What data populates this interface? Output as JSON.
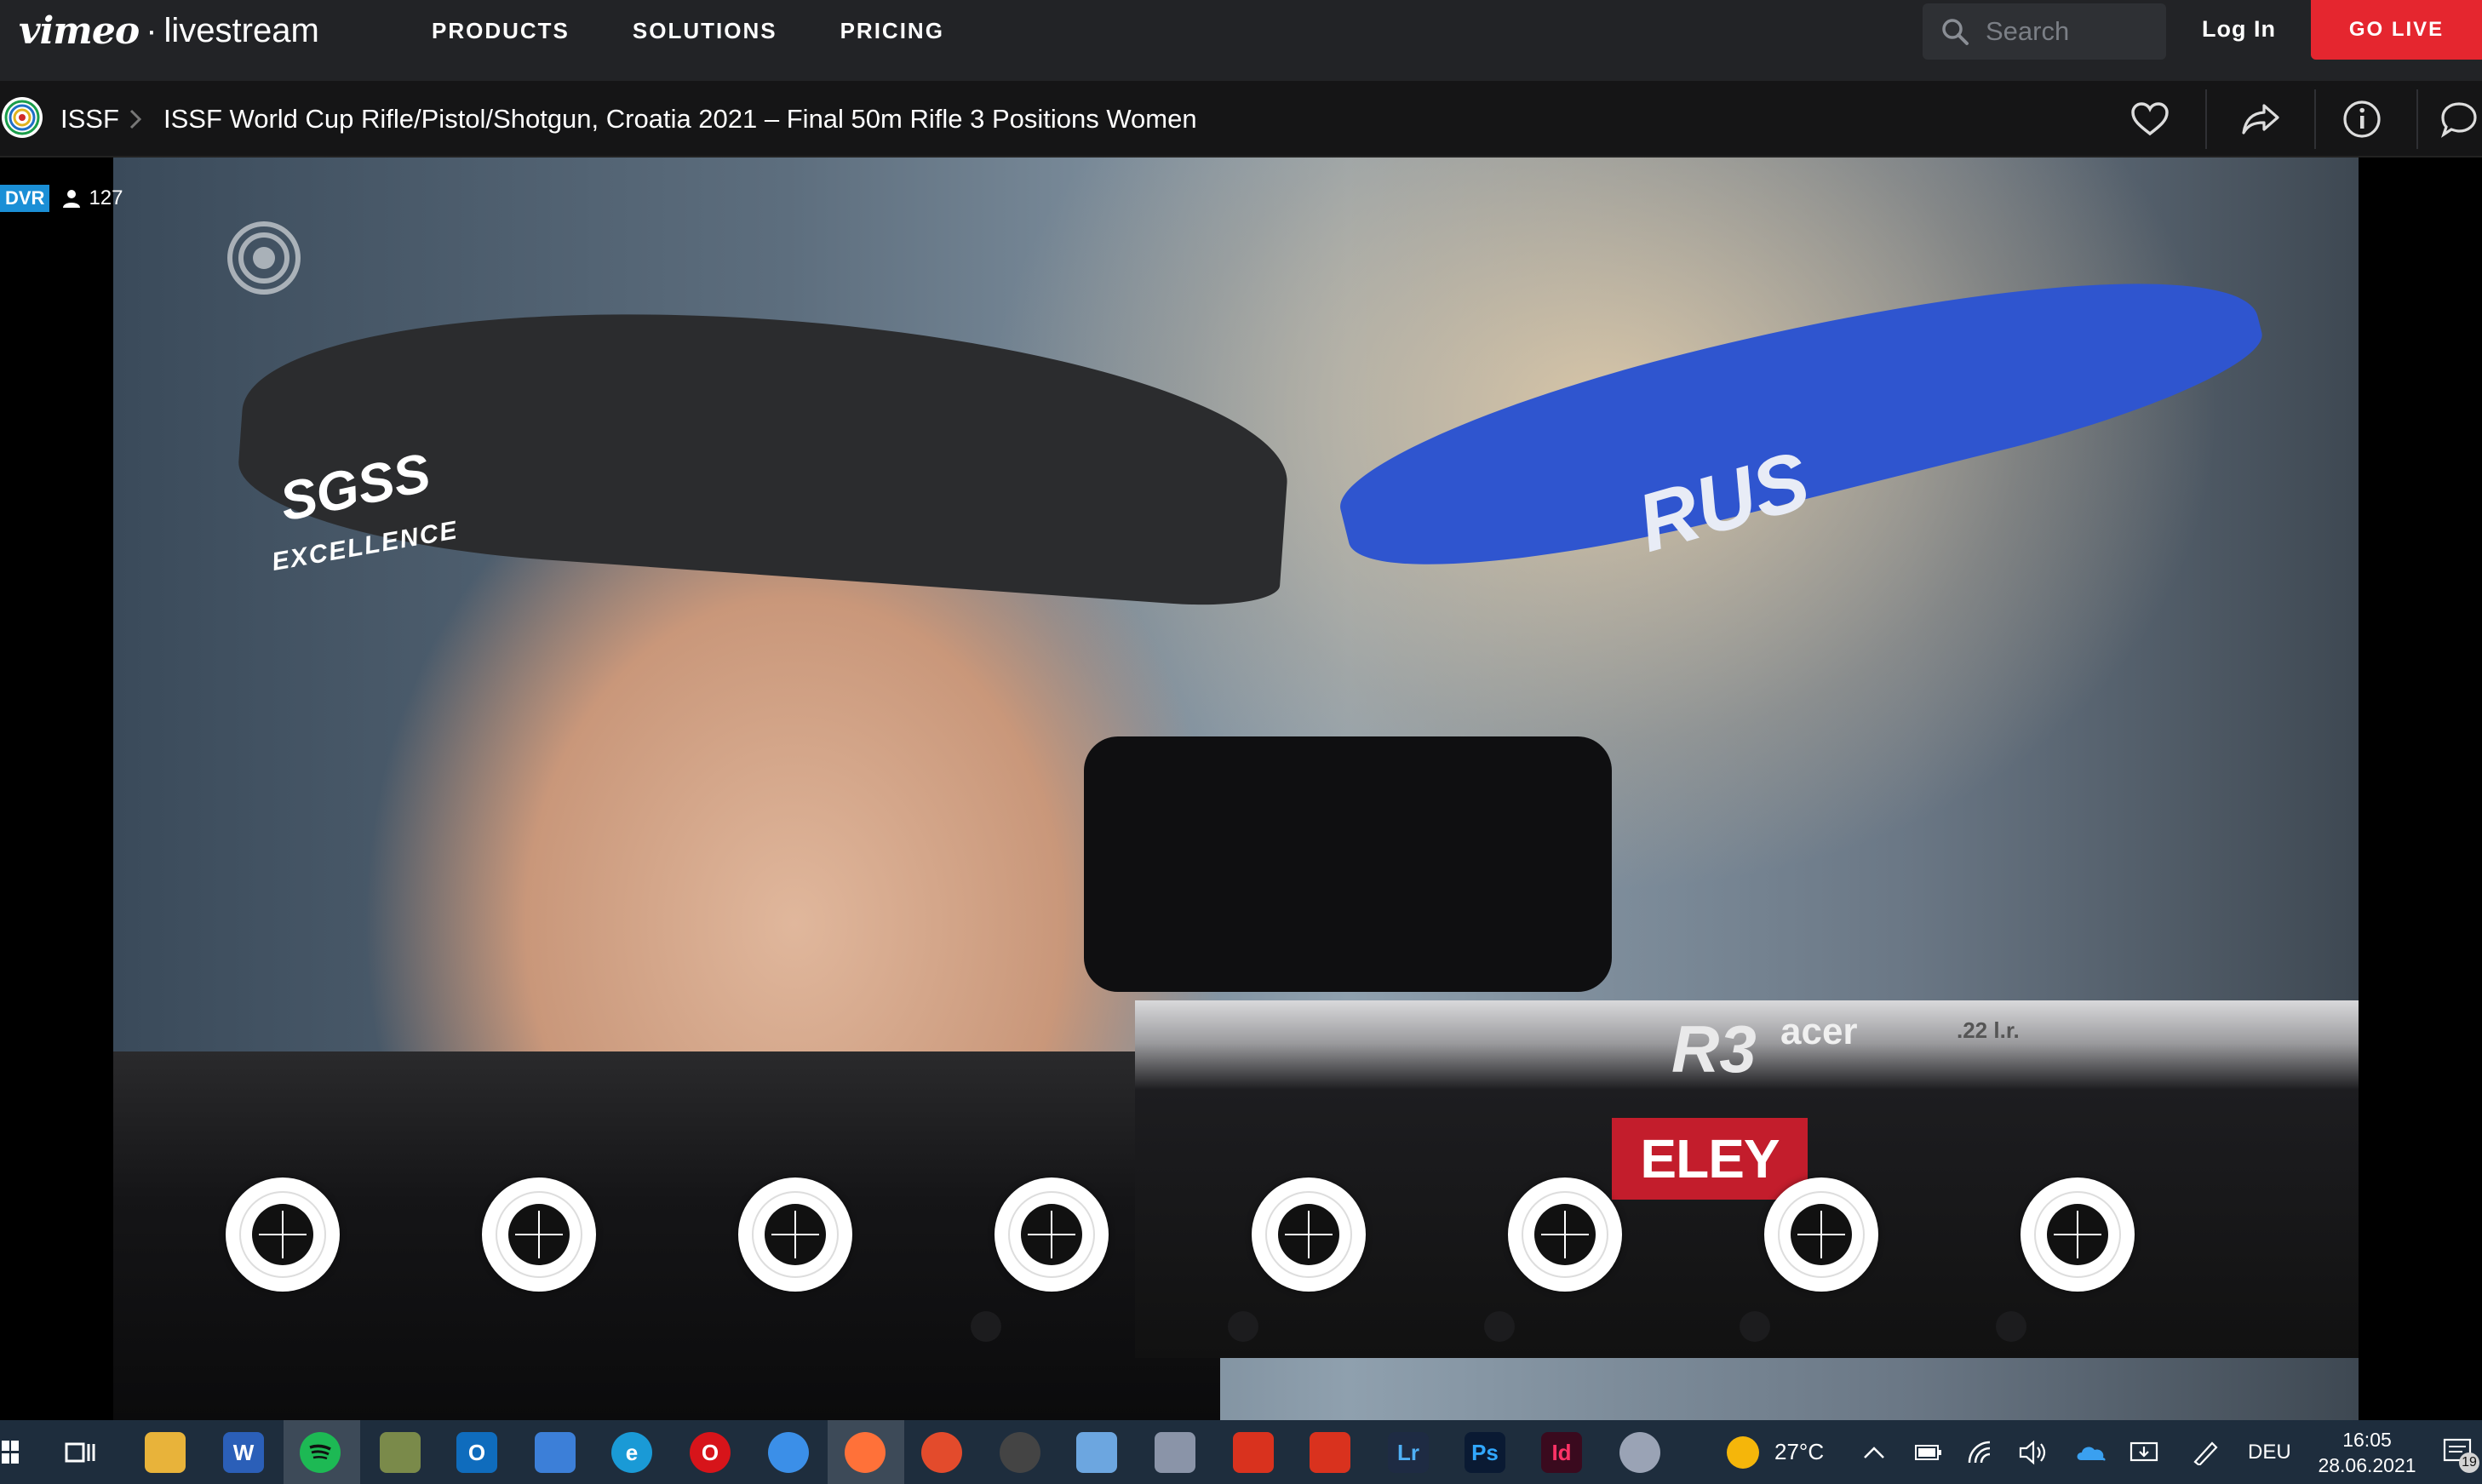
{
  "nav": {
    "brand_primary": "vimeo",
    "brand_separator": "·",
    "brand_secondary": "livestream",
    "links": [
      "PRODUCTS",
      "SOLUTIONS",
      "PRICING"
    ],
    "search_placeholder": "Search",
    "login_label": "Log In",
    "golive_label": "GO LIVE",
    "accent_color": "#e5262f"
  },
  "titlebar": {
    "channel": "ISSF",
    "event_title": "ISSF World Cup Rifle/Pistol/Shotgun, Croatia 2021 – Final 50m Rifle 3 Positions Women",
    "icons": [
      "heart-icon",
      "share-icon",
      "info-icon",
      "comment-icon"
    ]
  },
  "player": {
    "badge": "DVR",
    "viewer_count": "127",
    "watermark": "ISSF",
    "overlay_text": {
      "sgss": "SGSS",
      "excellence": "EXCELLENCE",
      "rus": "RUS",
      "r3": "R3",
      "acer": "acer",
      "caliber": ".22 l.r.",
      "eley": "ELEY"
    },
    "targets_count": 8
  },
  "taskbar": {
    "weather": "27°C",
    "language": "DEU",
    "time": "16:05",
    "date": "28.06.2021",
    "notification_count": "19",
    "apps": [
      "File Explorer",
      "Word",
      "Spotify",
      "Photos",
      "Outlook",
      "Files",
      "Edge",
      "Opera",
      "Safari",
      "Firefox",
      "App",
      "App",
      "App",
      "App",
      "Acrobat",
      "Acrobat Reader",
      "Lr",
      "Ps",
      "Id",
      "App"
    ]
  }
}
